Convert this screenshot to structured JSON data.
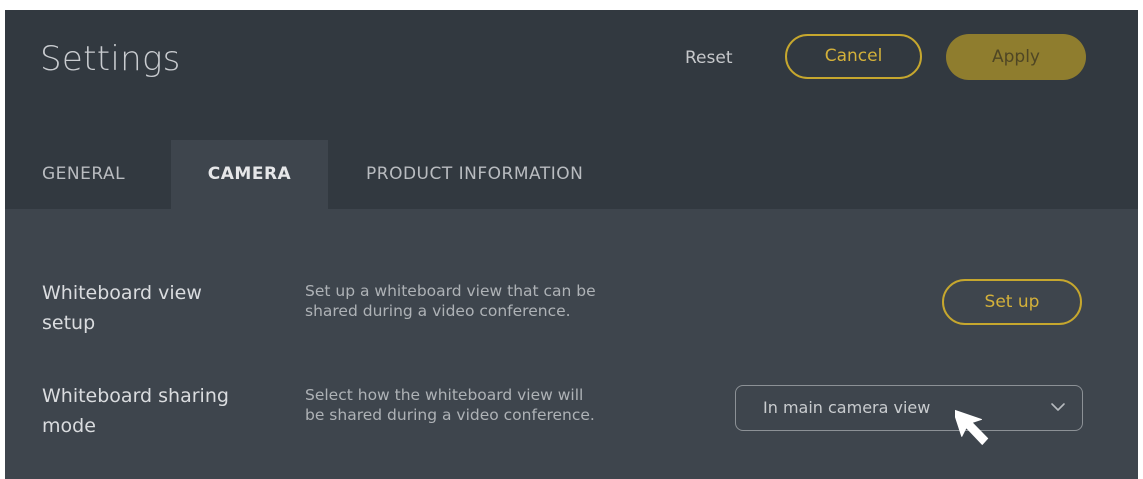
{
  "header": {
    "title": "Settings",
    "reset_label": "Reset",
    "cancel_label": "Cancel",
    "apply_label": "Apply"
  },
  "tabs": [
    {
      "label": "GENERAL",
      "active": false
    },
    {
      "label": "CAMERA",
      "active": true
    },
    {
      "label": "PRODUCT INFORMATION",
      "active": false
    }
  ],
  "settings": {
    "whiteboard_setup": {
      "label_line1": "Whiteboard view",
      "label_line2": "setup",
      "desc_line1": "Set up a whiteboard view that can be",
      "desc_line2": "shared during a video conference.",
      "button_label": "Set up"
    },
    "whiteboard_mode": {
      "label_line1": "Whiteboard sharing",
      "label_line2": "mode",
      "desc_line1": "Select how the whiteboard view will",
      "desc_line2": "be shared during a video conference.",
      "selected_value": "In main camera view"
    }
  },
  "icons": {
    "chevron": "chevron-down-icon",
    "cursor": "mouse-pointer-icon"
  },
  "colors": {
    "header_bg": "#323940",
    "content_bg": "#3e454d",
    "accent_gold": "#c6a72e",
    "apply_bg": "#8f7d2e"
  }
}
